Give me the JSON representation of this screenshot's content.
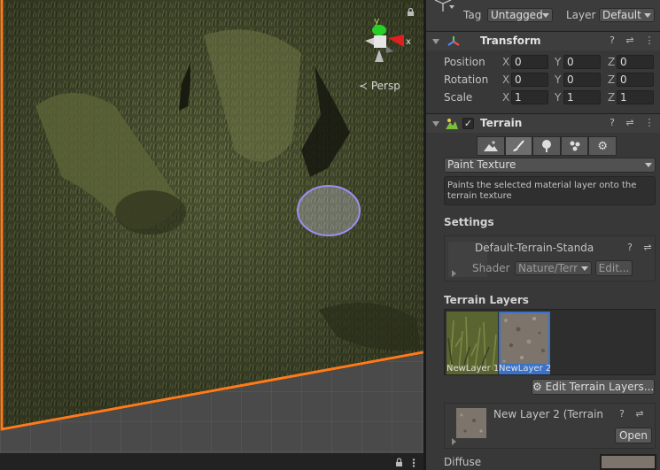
{
  "scene": {
    "projection_label": "≺ Persp",
    "gizmo": {
      "y_label": "y",
      "x_label": "x"
    }
  },
  "inspector": {
    "tag_label": "Tag",
    "tag_value": "Untagged",
    "layer_label": "Layer",
    "layer_value": "Default",
    "transform": {
      "title": "Transform",
      "rows": [
        {
          "label": "Position",
          "x": "0",
          "y": "0",
          "z": "0"
        },
        {
          "label": "Rotation",
          "x": "0",
          "y": "0",
          "z": "0"
        },
        {
          "label": "Scale",
          "x": "1",
          "y": "1",
          "z": "1"
        }
      ],
      "axis_x": "X",
      "axis_y": "Y",
      "axis_z": "Z"
    },
    "terrain": {
      "title": "Terrain",
      "tool_dropdown": "Paint Texture",
      "help_text": "Paints the selected material layer onto the terrain texture",
      "settings_header": "Settings",
      "material_name": "Default-Terrain-Standa",
      "shader_label": "Shader",
      "shader_value": "Nature/Terr",
      "edit_button": "Edit...",
      "layers_header": "Terrain Layers",
      "layers": [
        {
          "name": "NewLayer 1"
        },
        {
          "name": "NewLayer 2"
        }
      ],
      "edit_layers_button": "Edit Terrain Layers...",
      "selected_layer_name": "New Layer 2 (Terrain",
      "open_button": "Open",
      "diffuse_label": "Diffuse"
    }
  },
  "colors": {
    "selection_outline": "#ff7a1a",
    "selected_layer": "#3a72c8",
    "brush_preview": "#9b8ef0"
  }
}
